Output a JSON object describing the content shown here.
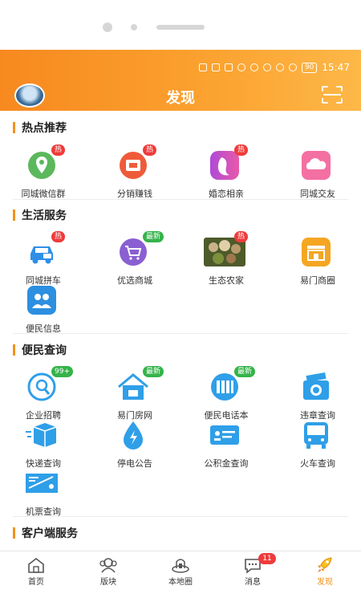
{
  "status_bar": {
    "battery": "90",
    "time": "15:47"
  },
  "header": {
    "title": "发现"
  },
  "sections": [
    {
      "title": "热点推荐",
      "items": [
        {
          "label": "同城微信群",
          "badge": "热",
          "badge_type": "hot",
          "icon": "location-pin-icon",
          "color": "#4caf50"
        },
        {
          "label": "分销赚钱",
          "badge": "热",
          "badge_type": "hot",
          "icon": "shopping-bag-icon",
          "color": "#ef5b3a"
        },
        {
          "label": "婚恋相亲",
          "badge": "热",
          "badge_type": "hot",
          "icon": "couple-icon",
          "color": "#c04bd6"
        },
        {
          "label": "同城交友",
          "badge": "",
          "badge_type": "",
          "icon": "cloud-icon",
          "color": "#f26fa0"
        }
      ]
    },
    {
      "title": "生活服务",
      "items": [
        {
          "label": "同城拼车",
          "badge": "热",
          "badge_type": "hot",
          "icon": "car-icon",
          "color": "#2f8fe8"
        },
        {
          "label": "优选商城",
          "badge": "最新",
          "badge_type": "new",
          "icon": "cart-icon",
          "color": "#8a5fd1"
        },
        {
          "label": "生态农家",
          "badge": "热",
          "badge_type": "hot",
          "icon": "food-photo-icon",
          "color": "#6b7c3a"
        },
        {
          "label": "易门商圈",
          "badge": "",
          "badge_type": "",
          "icon": "shop-icon",
          "color": "#f5a623"
        },
        {
          "label": "便民信息",
          "badge": "",
          "badge_type": "",
          "icon": "people-icon",
          "color": "#2d8fe0"
        }
      ]
    },
    {
      "title": "便民查询",
      "items": [
        {
          "label": "企业招聘",
          "badge": "99+",
          "badge_type": "new",
          "icon": "search-circle-icon",
          "color": "#2f9fe8"
        },
        {
          "label": "易门房网",
          "badge": "最新",
          "badge_type": "new",
          "icon": "house-icon",
          "color": "#2f9fe8"
        },
        {
          "label": "便民电话本",
          "badge": "最新",
          "badge_type": "new",
          "icon": "phonebook-icon",
          "color": "#2f9fe8"
        },
        {
          "label": "违章查询",
          "badge": "",
          "badge_type": "",
          "icon": "camera-icon",
          "color": "#2f9fe8"
        },
        {
          "label": "快递查询",
          "badge": "",
          "badge_type": "",
          "icon": "package-icon",
          "color": "#2f9fe8"
        },
        {
          "label": "停电公告",
          "badge": "",
          "badge_type": "",
          "icon": "lightning-icon",
          "color": "#2f9fe8"
        },
        {
          "label": "公积金查询",
          "badge": "",
          "badge_type": "",
          "icon": "id-card-icon",
          "color": "#2f9fe8"
        },
        {
          "label": "火车查询",
          "badge": "",
          "badge_type": "",
          "icon": "bus-icon",
          "color": "#2f9fe8"
        },
        {
          "label": "机票查询",
          "badge": "",
          "badge_type": "",
          "icon": "ticket-icon",
          "color": "#2f9fe8"
        }
      ]
    },
    {
      "title": "客户端服务",
      "items": []
    }
  ],
  "tabbar": {
    "tabs": [
      {
        "label": "首页",
        "icon": "home-icon"
      },
      {
        "label": "版块",
        "icon": "blocks-icon"
      },
      {
        "label": "本地圈",
        "icon": "local-circle-icon"
      },
      {
        "label": "消息",
        "icon": "message-icon",
        "badge": "11"
      },
      {
        "label": "发现",
        "icon": "rocket-icon",
        "active": true
      }
    ]
  },
  "colors": {
    "accent": "#f29115",
    "hot_badge": "#ee3b3b",
    "new_badge": "#35b34a"
  }
}
